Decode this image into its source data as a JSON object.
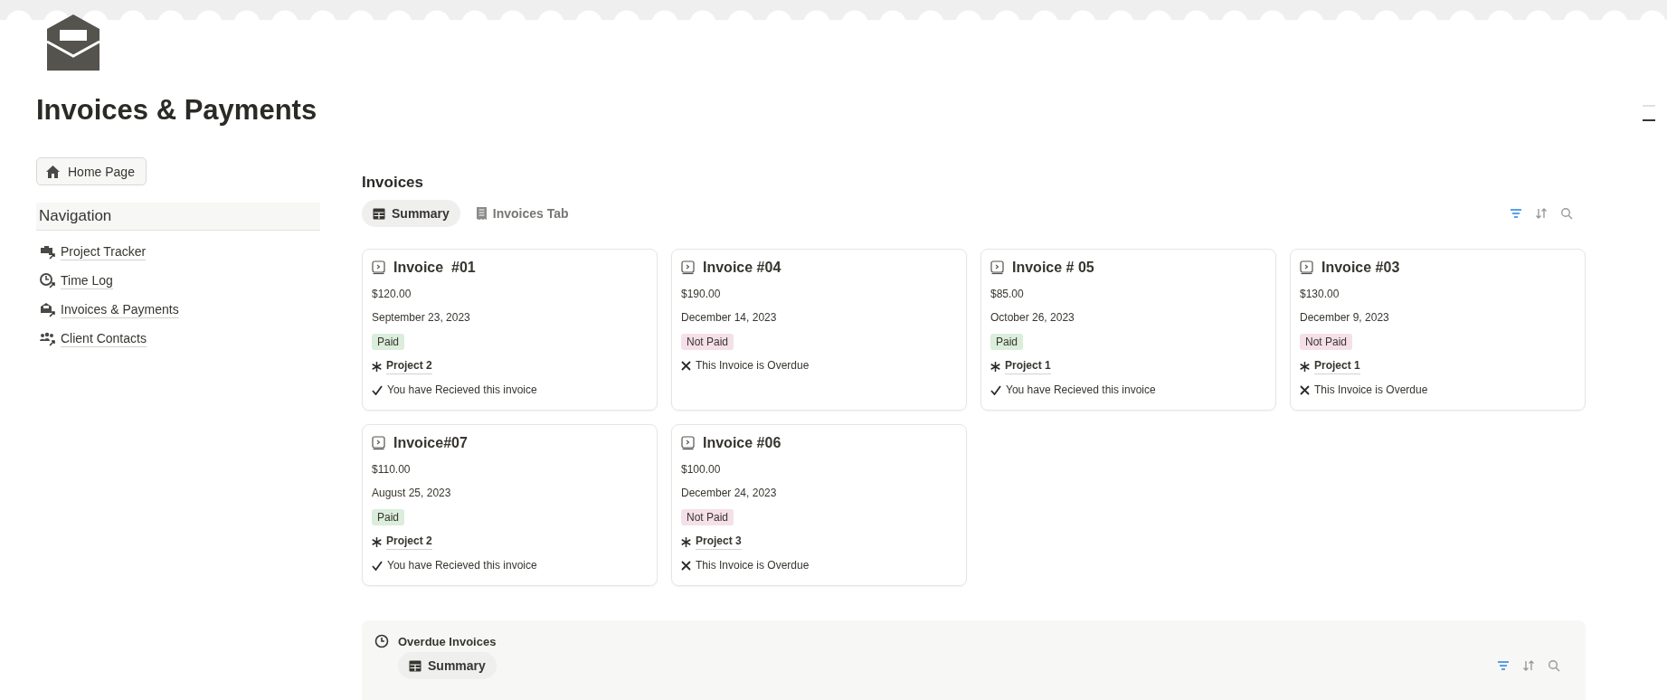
{
  "page": {
    "title": "Invoices & Payments"
  },
  "sidebar": {
    "home_button": "Home Page",
    "heading": "Navigation",
    "items": [
      {
        "kind": "briefcase",
        "label": "Project Tracker"
      },
      {
        "kind": "clock",
        "label": "Time Log"
      },
      {
        "kind": "envelope",
        "label": "Invoices & Payments"
      },
      {
        "kind": "people",
        "label": "Client Contacts"
      }
    ]
  },
  "invoices": {
    "heading": "Invoices",
    "tabs": [
      {
        "kind": "table",
        "label": "Summary",
        "selected": true
      },
      {
        "kind": "receipt",
        "label": "Invoices Tab",
        "selected": false
      }
    ],
    "filter_active": true,
    "cards": [
      {
        "title": "Invoice  #01",
        "amount": "$120.00",
        "date": "September 23, 2023",
        "status": {
          "label": "Paid",
          "color": "#dbeddb"
        },
        "project": "Project 2",
        "note": {
          "kind": "check",
          "text": "You have Recieved this invoice"
        }
      },
      {
        "title": "Invoice #04",
        "amount": "$190.00",
        "date": "December 14, 2023",
        "status": {
          "label": "Not Paid",
          "color": "#f5e0e9"
        },
        "note": {
          "kind": "cross",
          "text": "This Invoice is Overdue"
        }
      },
      {
        "title": "Invoice # 05",
        "amount": "$85.00",
        "date": "October 26, 2023",
        "status": {
          "label": "Paid",
          "color": "#dbeddb"
        },
        "project": "Project 1",
        "note": {
          "kind": "check",
          "text": "You have Recieved this invoice"
        }
      },
      {
        "title": "Invoice #03",
        "amount": "$130.00",
        "date": "December 9, 2023",
        "status": {
          "label": "Not Paid",
          "color": "#f5e0e9"
        },
        "project": "Project 1",
        "note": {
          "kind": "cross",
          "text": "This Invoice is Overdue"
        }
      },
      {
        "title": "Invoice#07",
        "amount": "$110.00",
        "date": "August 25, 2023",
        "status": {
          "label": "Paid",
          "color": "#dbeddb"
        },
        "project": "Project 2",
        "note": {
          "kind": "check",
          "text": "You have Recieved this invoice"
        }
      },
      {
        "title": "Invoice #06",
        "amount": "$100.00",
        "date": "December 24, 2023",
        "status": {
          "label": "Not Paid",
          "color": "#f5e0e9"
        },
        "project": "Project 3",
        "note": {
          "kind": "cross",
          "text": "This Invoice is Overdue"
        }
      }
    ]
  },
  "overdue": {
    "heading": "Overdue Invoices",
    "tabs": [
      {
        "kind": "table",
        "label": "Summary",
        "selected": true
      }
    ],
    "filter_active": true
  }
}
